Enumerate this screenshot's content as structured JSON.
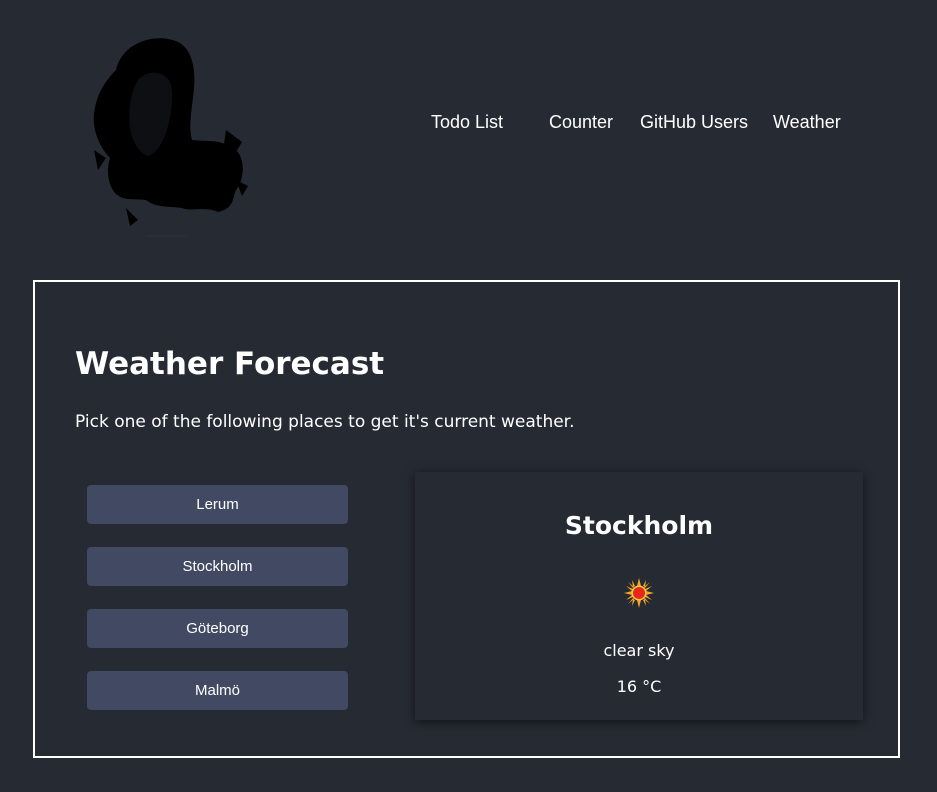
{
  "nav": {
    "items": [
      {
        "label": "Todo List"
      },
      {
        "label": "Counter"
      },
      {
        "label": "GitHub Users"
      },
      {
        "label": "Weather"
      }
    ]
  },
  "main": {
    "title": "Weather Forecast",
    "subtitle": "Pick one of the following places to get it's current weather.",
    "places": [
      {
        "label": "Lerum"
      },
      {
        "label": "Stockholm"
      },
      {
        "label": "Göteborg"
      },
      {
        "label": "Malmö"
      }
    ]
  },
  "weather": {
    "city": "Stockholm",
    "icon": "sun-icon",
    "description": "clear sky",
    "temperature": "16 °C"
  },
  "colors": {
    "background": "#262a33",
    "button": "#414a62",
    "border": "#ffffff",
    "sun": "#e8261a"
  }
}
